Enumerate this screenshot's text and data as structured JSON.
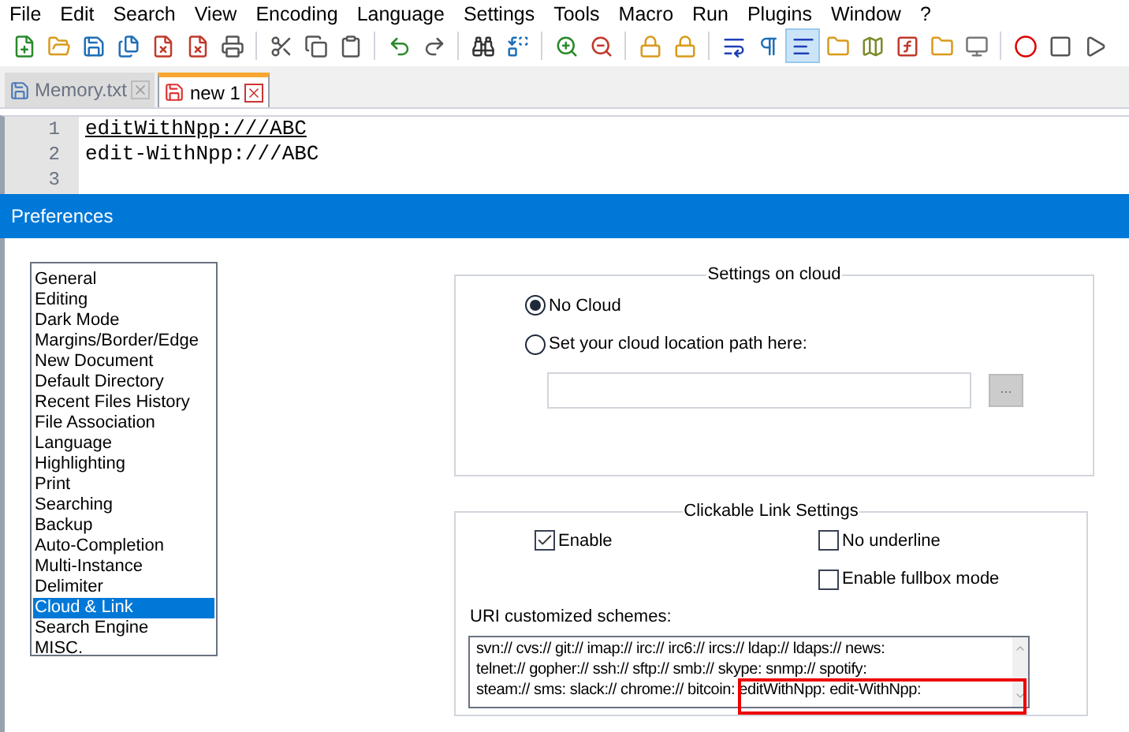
{
  "menu": [
    "File",
    "Edit",
    "Search",
    "View",
    "Encoding",
    "Language",
    "Settings",
    "Tools",
    "Macro",
    "Run",
    "Plugins",
    "Window",
    "?"
  ],
  "toolbar": [
    [
      {
        "kind": "new",
        "active": false
      },
      {
        "kind": "open",
        "active": false
      },
      {
        "kind": "save",
        "active": false
      },
      {
        "kind": "saveall",
        "active": false
      },
      {
        "kind": "close",
        "active": false
      },
      {
        "kind": "closeall",
        "active": false
      },
      {
        "kind": "print",
        "active": false
      }
    ],
    [
      {
        "kind": "cut",
        "active": false
      },
      {
        "kind": "copy",
        "active": false
      },
      {
        "kind": "paste",
        "active": false
      }
    ],
    [
      {
        "kind": "undo",
        "active": false
      },
      {
        "kind": "redo",
        "active": false
      }
    ],
    [
      {
        "kind": "find",
        "active": false
      },
      {
        "kind": "replace",
        "active": false
      }
    ],
    [
      {
        "kind": "zoomin",
        "active": false
      },
      {
        "kind": "zoomout",
        "active": false
      }
    ],
    [
      {
        "kind": "lock",
        "active": false
      },
      {
        "kind": "lock",
        "active": false
      }
    ],
    [
      {
        "kind": "wrap",
        "active": false
      },
      {
        "kind": "pilcrow",
        "active": false
      },
      {
        "kind": "indent",
        "active": true
      },
      {
        "kind": "folder",
        "active": false
      },
      {
        "kind": "map",
        "active": false
      },
      {
        "kind": "function",
        "active": false
      },
      {
        "kind": "folder",
        "active": false
      },
      {
        "kind": "monitor",
        "active": false
      }
    ],
    [
      {
        "kind": "record",
        "active": false
      },
      {
        "kind": "stop",
        "active": false
      },
      {
        "kind": "play",
        "active": false
      }
    ]
  ],
  "tabs": [
    {
      "label": "Memory.txt",
      "selected": false
    },
    {
      "label": "new 1",
      "selected": true
    }
  ],
  "editor": {
    "lines": [
      {
        "number": "1",
        "text": "editWithNpp:///ABC",
        "link": true
      },
      {
        "number": "2",
        "text": "edit-WithNpp:///ABC",
        "link": false
      },
      {
        "number": "3"
      }
    ]
  },
  "dialog": {
    "title": "Preferences",
    "categories": [
      {
        "label": "General",
        "selected": false
      },
      {
        "label": "Editing",
        "selected": false
      },
      {
        "label": "Dark Mode",
        "selected": false
      },
      {
        "label": "Margins/Border/Edge",
        "selected": false
      },
      {
        "label": "New Document",
        "selected": false
      },
      {
        "label": "Default Directory",
        "selected": false
      },
      {
        "label": "Recent Files History",
        "selected": false
      },
      {
        "label": "File Association",
        "selected": false
      },
      {
        "label": "Language",
        "selected": false
      },
      {
        "label": "Highlighting",
        "selected": false
      },
      {
        "label": "Print",
        "selected": false
      },
      {
        "label": "Searching",
        "selected": false
      },
      {
        "label": "Backup",
        "selected": false
      },
      {
        "label": "Auto-Completion",
        "selected": false
      },
      {
        "label": "Multi-Instance",
        "selected": false
      },
      {
        "label": "Delimiter",
        "selected": false
      },
      {
        "label": "Cloud & Link",
        "selected": true
      },
      {
        "label": "Search Engine",
        "selected": false
      },
      {
        "label": "MISC.",
        "selected": false
      }
    ],
    "cloud": {
      "title": "Settings on cloud",
      "options": [
        {
          "label": "No Cloud",
          "selected": true
        },
        {
          "label": "Set your cloud location path here:",
          "selected": false
        }
      ],
      "browse_button": "..."
    },
    "links": {
      "title": "Clickable Link Settings",
      "checkboxes": [
        {
          "label": "Enable",
          "checked": true
        },
        {
          "label": "No underline",
          "checked": false
        },
        {
          "label": "Enable fullbox mode",
          "checked": false
        }
      ],
      "schemes_label": "URI customized schemes:",
      "schemes_lines": [
        "svn:// cvs:// git:// imap:// irc:// irc6:// ircs:// ldap:// ldaps:// news:",
        "telnet:// gopher:// ssh:// sftp:// smb:// skype: snmp:// spotify:",
        "steam:// sms: slack:// chrome:// bitcoin: editWithNpp: edit-WithNpp:"
      ]
    }
  }
}
